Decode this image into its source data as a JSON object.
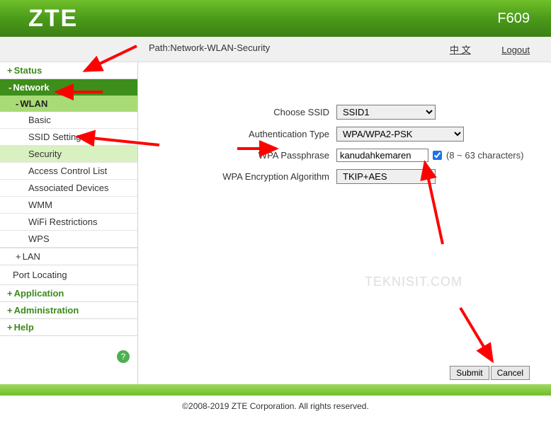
{
  "header": {
    "brand": "ZTE",
    "model": "F609"
  },
  "topbar": {
    "path": "Path:Network-WLAN-Security",
    "lang": "中 文",
    "logout": "Logout"
  },
  "sidebar": {
    "status": "Status",
    "network": "Network",
    "wlan": "WLAN",
    "items": {
      "basic": "Basic",
      "ssid": "SSID Settings",
      "security": "Security",
      "acl": "Access Control List",
      "assoc": "Associated Devices",
      "wmm": "WMM",
      "wifir": "WiFi Restrictions",
      "wps": "WPS"
    },
    "lan": "LAN",
    "port": "Port Locating",
    "application": "Application",
    "administration": "Administration",
    "help": "Help",
    "help_icon": "?"
  },
  "form": {
    "labels": {
      "ssid": "Choose SSID",
      "auth": "Authentication Type",
      "pass": "WPA Passphrase",
      "enc": "WPA Encryption Algorithm"
    },
    "values": {
      "ssid": "SSID1",
      "auth": "WPA/WPA2-PSK",
      "pass": "kanudahkemaren",
      "enc": "TKIP+AES"
    },
    "hint": "(8 ~ 63 characters)"
  },
  "watermark": "TEKNISIT.COM",
  "buttons": {
    "submit": "Submit",
    "cancel": "Cancel"
  },
  "footer": "©2008-2019 ZTE Corporation. All rights reserved."
}
